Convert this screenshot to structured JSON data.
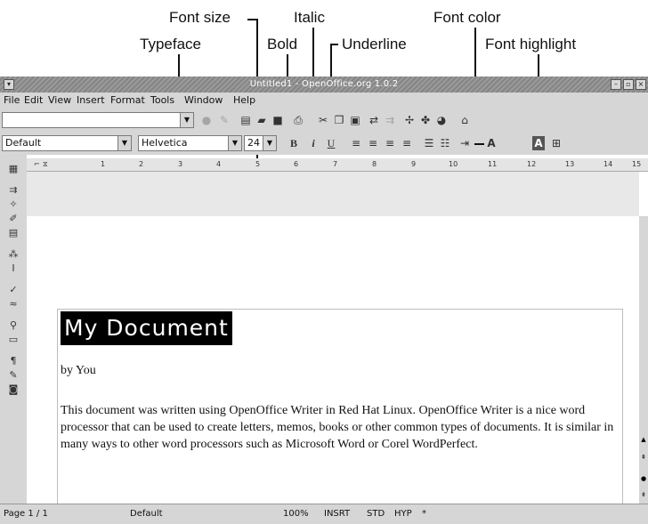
{
  "callouts": {
    "font_size": "Font size",
    "italic": "Italic",
    "font_color": "Font color",
    "typeface": "Typeface",
    "bold": "Bold",
    "underline": "Underline",
    "font_highlight": "Font highlight"
  },
  "window": {
    "title": "Untitled1 - OpenOffice.org 1.0.2"
  },
  "menu": {
    "file": "File",
    "edit": "Edit",
    "view": "View",
    "insert": "Insert",
    "format": "Format",
    "tools": "Tools",
    "window": "Window",
    "help": "Help"
  },
  "toolbar": {
    "style": "Default",
    "typeface": "Helvetica",
    "font_size": "24",
    "bold": "B",
    "italic": "i",
    "underline": "U",
    "font_color": "A",
    "highlight": "A"
  },
  "ruler": [
    "1",
    "2",
    "3",
    "4",
    "5",
    "6",
    "7",
    "8",
    "9",
    "10",
    "11",
    "12",
    "13",
    "14",
    "15"
  ],
  "document": {
    "title": "My Document",
    "byline": "by You",
    "body": "This document was written using OpenOffice Writer in Red Hat Linux. OpenOffice Writer is a nice word processor that can be used to create letters, memos, books or other common types of documents. It is similar in many ways to other word processors such as Microsoft Word or Corel WordPerfect."
  },
  "status": {
    "page": "Page 1 / 1",
    "style": "Default",
    "zoom": "100%",
    "insert": "INSRT",
    "std": "STD",
    "hyp": "HYP",
    "modified": "*"
  }
}
